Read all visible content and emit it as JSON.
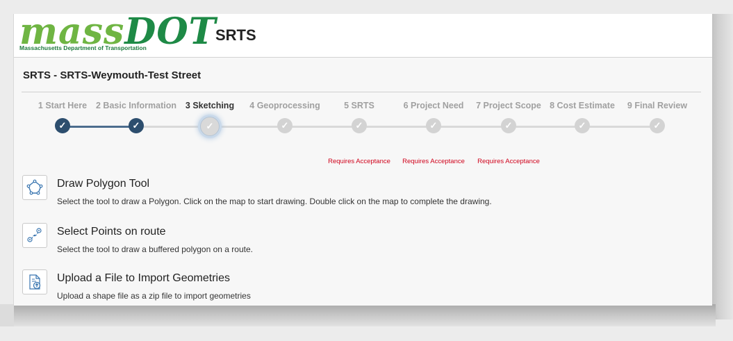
{
  "header": {
    "logo_text_mass": "mass",
    "logo_text_dot": "DOT",
    "logo_subtitle": "Massachusetts Department of Transportation",
    "app_title": "SRTS"
  },
  "project": {
    "title": "SRTS - SRTS-Weymouth-Test Street"
  },
  "steps": [
    {
      "label": "1 Start Here",
      "status": "complete"
    },
    {
      "label": "2 Basic Information",
      "status": "complete"
    },
    {
      "label": "3 Sketching",
      "status": "active"
    },
    {
      "label": "4 Geoprocessing",
      "status": "pending"
    },
    {
      "label": "5 SRTS",
      "status": "pending",
      "note": "Requires Acceptance"
    },
    {
      "label": "6 Project Need",
      "status": "pending",
      "note": "Requires Acceptance"
    },
    {
      "label": "7 Project Scope",
      "status": "pending",
      "note": "Requires Acceptance"
    },
    {
      "label": "8 Cost Estimate",
      "status": "pending"
    },
    {
      "label": "9 Final Review",
      "status": "pending"
    }
  ],
  "step_check": "✓",
  "tools": [
    {
      "icon": "polygon-icon",
      "title": "Draw Polygon Tool",
      "description": "Select the tool to draw a Polygon. Click on the map to start drawing. Double click on the map to complete the drawing."
    },
    {
      "icon": "route-points-icon",
      "title": "Select Points on route",
      "description": "Select the tool to draw a buffered polygon on a route."
    },
    {
      "icon": "file-upload-icon",
      "title": "Upload a File to Import Geometries",
      "description": "Upload a shape file as a zip file to import geometries"
    }
  ],
  "colors": {
    "brand_green_light": "#6fb543",
    "brand_green_dark": "#1e8a46",
    "step_complete": "#2d4e6e",
    "step_pending": "#d3d3d3",
    "requires_acceptance": "#d0021b",
    "icon_blue": "#3a76b0"
  }
}
